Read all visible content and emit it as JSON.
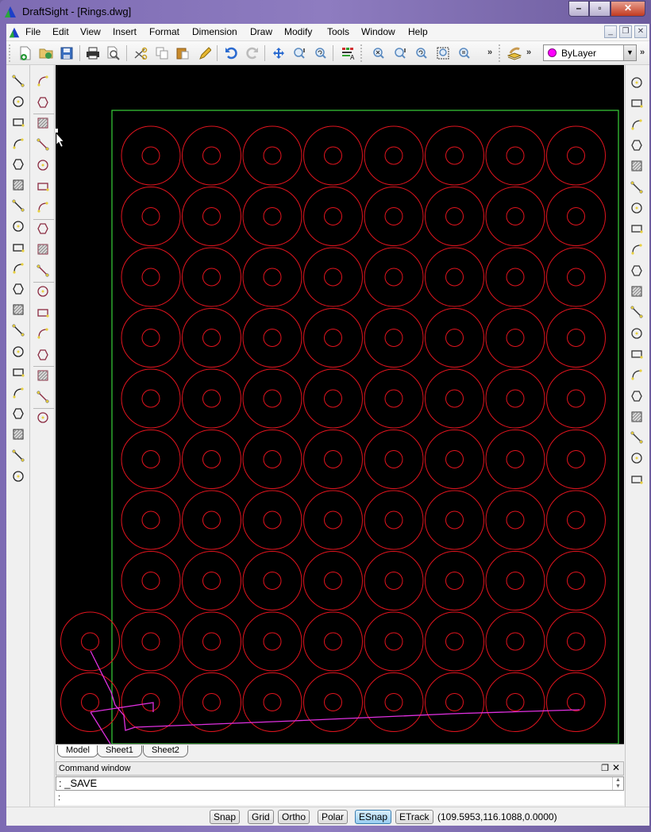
{
  "window": {
    "title": "DraftSight - [Rings.dwg]",
    "controls": {
      "minimize": "–",
      "maximize": "▫",
      "close": "✕"
    }
  },
  "menubar": {
    "items": [
      "File",
      "Edit",
      "View",
      "Insert",
      "Format",
      "Dimension",
      "Draw",
      "Modify",
      "Tools",
      "Window",
      "Help"
    ],
    "mdi_controls": {
      "minimize": "_",
      "restore": "❐",
      "close": "✕"
    }
  },
  "toolbar": {
    "buttons": [
      "new-icon",
      "open-icon",
      "save-icon",
      "print-icon",
      "print-preview-icon",
      "cut-icon",
      "copy-icon",
      "paste-icon",
      "format-painter-icon",
      "undo-icon",
      "redo-icon",
      "pan-icon",
      "zoom-dynamic-icon",
      "zoom-previous-icon",
      "layer-manager-icon",
      "zoom-fit-icon",
      "zoom-in-icon",
      "zoom-out-previous-icon",
      "zoom-window-icon",
      "zoom-out-icon"
    ],
    "overflow": "»",
    "layer_select": {
      "value": "ByLayer",
      "color": "#ff00ff"
    }
  },
  "draw_toolbar": [
    "line",
    "infinite-line",
    "polygon",
    "rectangle",
    "arc",
    "arc-3pt",
    "circle",
    "ellipse",
    "elliptical-arc",
    "point",
    "spline",
    "hatch",
    "insert-block",
    "wipeout",
    "note",
    "simple-note",
    "revision-cloud",
    "rect-cloud",
    "circle-cloud",
    "freehand-cloud"
  ],
  "dimension_toolbar": [
    "smart-dimension",
    "linear-dimension",
    "angular-dimension",
    "arc-dimension",
    "aligned-dimension",
    "baseline-dimension",
    "ordinate-dimension",
    "radius-dimension",
    "diameter-dimension",
    "jogged-dimension",
    "leader",
    "smart-leader",
    "parallel",
    "perpendicular",
    "center-mark",
    "break-dimension",
    "edit-dimension"
  ],
  "modify_toolbar": [
    "erase",
    "copy",
    "mirror",
    "move",
    "offset",
    "pattern",
    "rotate",
    "scale",
    "stretch",
    "fillet",
    "chamfer",
    "trim",
    "extend",
    "join",
    "split",
    "explode",
    "hatch-edit",
    "bring-front",
    "edit-block",
    "explode-bomb"
  ],
  "drawing": {
    "rows": 10,
    "cols": 8,
    "ring_color": "#e0141e",
    "frame_color": "#39d23a",
    "path_color": "#e030e0",
    "extra_rings_left_column_rows": 2
  },
  "sheet_tabs": [
    "Model",
    "Sheet1",
    "Sheet2"
  ],
  "command_window": {
    "title": "Command window",
    "history": ": _SAVE",
    "prompt": ":"
  },
  "statusbar": {
    "toggles": [
      {
        "label": "Snap",
        "on": false
      },
      {
        "label": "Grid",
        "on": false
      },
      {
        "label": "Ortho",
        "on": false
      },
      {
        "label": "Polar",
        "on": false
      },
      {
        "label": "ESnap",
        "on": true
      },
      {
        "label": "ETrack",
        "on": false
      }
    ],
    "coordinates": "(109.5953,116.1088,0.0000)"
  }
}
